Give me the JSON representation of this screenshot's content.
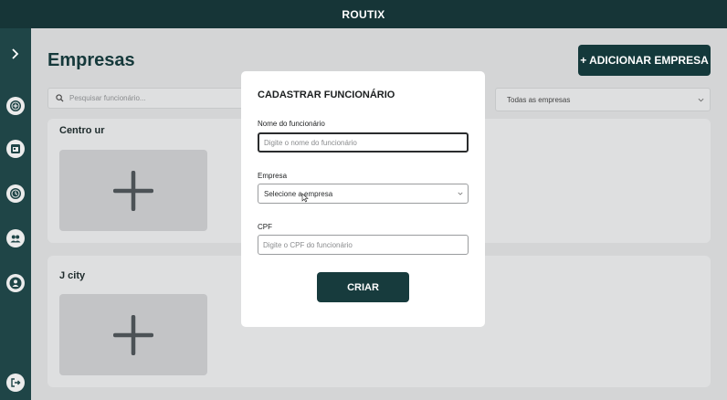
{
  "app": {
    "title": "ROUTIX"
  },
  "sidebar": {
    "toggle_icon": "chevron-right-icon",
    "items": [
      {
        "name": "add-circle",
        "icon": "add-circle-icon"
      },
      {
        "name": "calendar",
        "icon": "calendar-icon"
      },
      {
        "name": "clock",
        "icon": "clock-icon"
      },
      {
        "name": "group",
        "icon": "group-icon"
      },
      {
        "name": "user",
        "icon": "user-icon"
      },
      {
        "name": "logout",
        "icon": "logout-icon"
      }
    ]
  },
  "header": {
    "title": "Empresas",
    "add_button_label": "+ ADICIONAR EMPRESA"
  },
  "search": {
    "placeholder": "Pesquisar funcionário..."
  },
  "filter": {
    "selected": "Todas as empresas"
  },
  "companies": [
    {
      "name": "Centro ur"
    },
    {
      "name": "J city"
    }
  ],
  "modal": {
    "title": "CADASTRAR FUNCIONÁRIO",
    "name_label": "Nome do funcionário",
    "name_placeholder": "Digite o nome do funcionário",
    "company_label": "Empresa",
    "company_selected": "Selecione a empresa",
    "cpf_label": "CPF",
    "cpf_placeholder": "Digite o CPF do funcionário",
    "create_label": "CRIAR"
  },
  "colors": {
    "topbar": "#163537",
    "sidebar": "#1f4547",
    "primary_button": "#14393b",
    "background": "#d4d5d6"
  }
}
